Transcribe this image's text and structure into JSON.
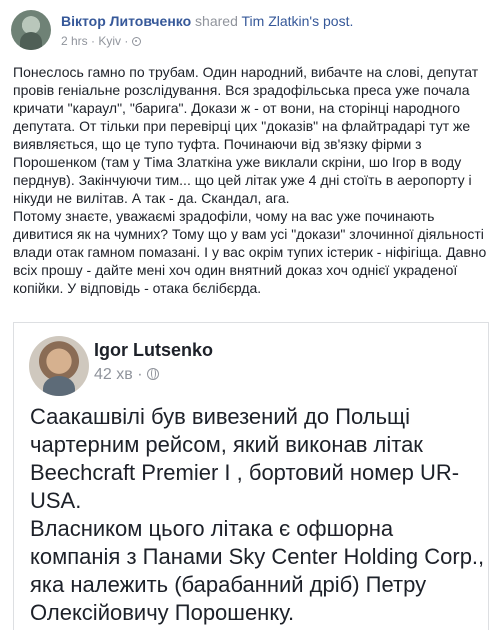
{
  "post": {
    "author": "Віктор Литовченко",
    "shared_text": "shared",
    "shared_link": "Tim Zlatkin's post.",
    "time": "2 hrs",
    "separator": "·",
    "location": "Kyiv",
    "paragraphs": [
      "Понеслось гамно по трубам. Один народний, вибачте на слові, депутат провів геніальне розслідування. Вся зрадофільська преса уже почала кричати \"караул\", \"барига\". Докази ж - от вони, на сторінці народного депутата. От тільки при перевірці цих \"доказів\" на флайтрадарі тут же виявляється, що це тупо туфта. Починаючи від зв'язку фірми з Порошенком (там у Тіма Златкіна уже виклали скріни, шо Ігор в воду перднув). Закінчуючи тим... що цей літак уже 4 дні стоїть в аеропорту і нікуди не вилітав. А так - да. Скандал, ага.",
      "Потому знаєте, уважаємі зрадофіли, чому на вас уже починають дивитися як на чумних? Тому що у вам усі \"докази\" злочинної діяльності влади отак гамном помазані. І у вас окрім тупих істерик - ніфігіща. Давно всіх прошу - дайте мені хоч один внятний доказ хоч однієї украденої копійки. У відповідь - отака бєлібєрда."
    ]
  },
  "shared": {
    "author": "Igor Lutsenko",
    "time": "42 хв",
    "separator": "·",
    "paragraphs": [
      "Саакашвілі був вивезений до Польщі чартерним рейсом, який виконав літак Beechcraft Premier I , бортовий номер UR-USA.",
      "Власником цього літака є офшорна компанія з Панами  Sky Center Holding Corp., яка належить (барабанний дріб) Петру Олексійовичу Порошенку."
    ]
  }
}
